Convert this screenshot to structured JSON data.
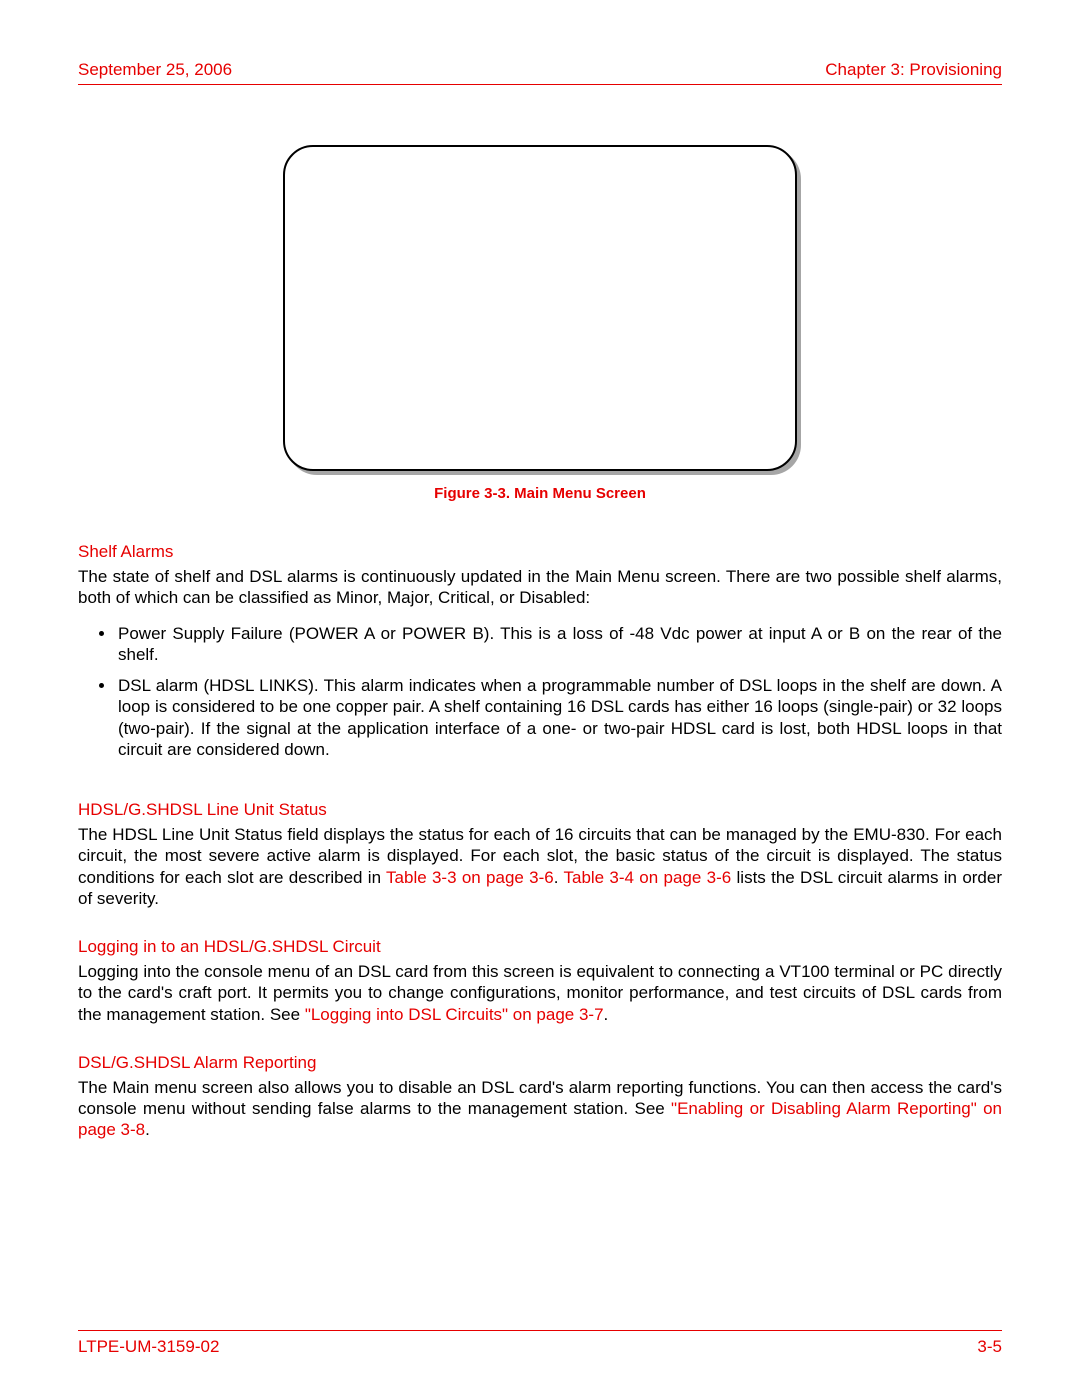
{
  "header": {
    "date": "September 25, 2006",
    "chapter": "Chapter 3: Provisioning"
  },
  "figure": {
    "caption": "Figure 3-3. Main Menu Screen"
  },
  "sections": {
    "shelf_alarms": {
      "heading": "Shelf Alarms",
      "intro": "The state of shelf and DSL alarms is continuously updated in the Main Menu screen. There are two possible shelf alarms, both of which can be classified as Minor, Major, Critical, or Disabled:",
      "bullets": [
        "Power Supply Failure (POWER A or POWER B). This is a loss of -48 Vdc power at input A or B on the rear of the shelf.",
        "DSL alarm (HDSL LINKS). This alarm indicates when a programmable number of DSL loops in the shelf are down. A loop is considered to be one copper pair. A shelf containing 16 DSL cards has either 16 loops (single-pair) or 32 loops (two-pair). If the signal at the application interface of a one- or two-pair HDSL card is lost, both HDSL loops in that circuit are considered down."
      ]
    },
    "line_unit_status": {
      "heading": "HDSL/G.SHDSL Line Unit Status",
      "text_pre": "The HDSL Line Unit Status field displays the status for each of 16 circuits that can be managed by the EMU-830. For each circuit, the most severe active alarm is displayed. For each slot, the basic status of the circuit is displayed. The status conditions for each slot are described in ",
      "link1": "Table 3-3 on page 3-6",
      "mid": ". ",
      "link2": "Table 3-4 on page 3-6",
      "text_post": " lists the DSL circuit alarms in order of severity."
    },
    "logging_in": {
      "heading": "Logging in to an HDSL/G.SHDSL Circuit",
      "text_pre": "Logging into the console menu of an DSL card from this screen is equivalent to connecting a VT100 terminal or PC directly to the card's craft port. It permits you to change configurations, monitor performance, and test circuits of DSL cards from the management station. See ",
      "link": "\"Logging into DSL Circuits\" on page 3-7",
      "text_post": "."
    },
    "alarm_reporting": {
      "heading": "DSL/G.SHDSL Alarm Reporting",
      "text_pre": "The Main menu screen also allows you to disable an DSL card's alarm reporting functions. You can then access the card's console menu without sending false alarms to the management station. See ",
      "link": "\"Enabling or Disabling Alarm Reporting\" on page 3-8",
      "text_post": "."
    }
  },
  "footer": {
    "doc_id": "LTPE-UM-3159-02",
    "page": "3-5"
  }
}
